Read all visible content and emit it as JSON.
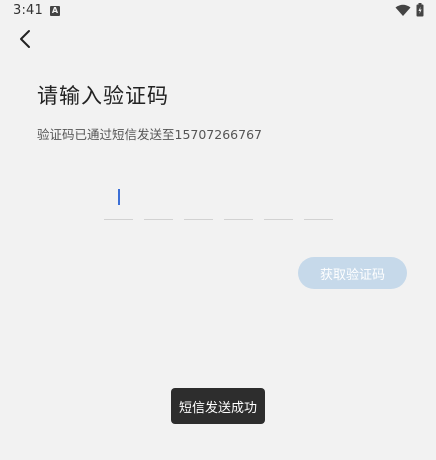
{
  "status_bar": {
    "time": "3:41",
    "notification_icon": "a-icon",
    "wifi_icon": "wifi-icon",
    "battery_icon": "battery-icon"
  },
  "header": {
    "back_icon": "chevron-left-icon"
  },
  "main": {
    "title": "请输入验证码",
    "subtitle": "验证码已通过短信发送至15707266767",
    "code_digits": [
      "",
      "",
      "",
      "",
      "",
      ""
    ],
    "get_code_label": "获取验证码"
  },
  "toast": {
    "message": "短信发送成功"
  },
  "colors": {
    "background": "#f2f2f2",
    "button": "#c6d9ea",
    "cursor": "#3b6fd6",
    "toast": "#2d2d2d"
  }
}
